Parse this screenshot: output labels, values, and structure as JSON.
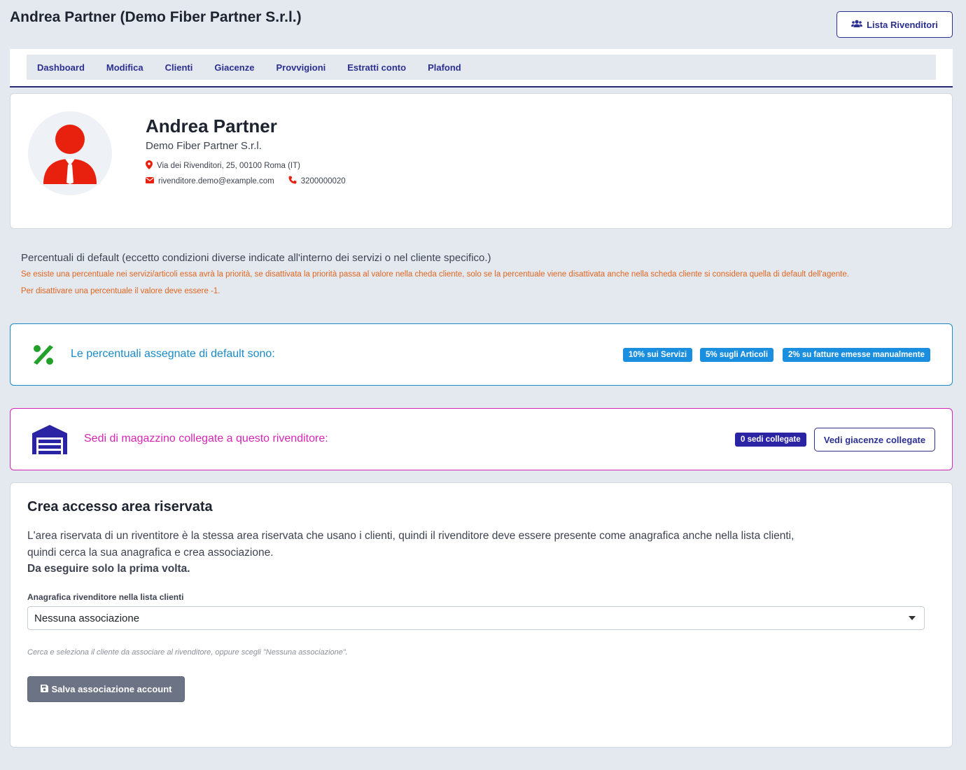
{
  "header": {
    "title": "Andrea Partner (Demo Fiber Partner S.r.l.)",
    "resellers_button": "Lista Rivenditori"
  },
  "nav": {
    "items": [
      "Dashboard",
      "Modifica",
      "Clienti",
      "Giacenze",
      "Provvigioni",
      "Estratti conto",
      "Plafond"
    ]
  },
  "profile": {
    "name": "Andrea Partner",
    "company": "Demo Fiber Partner S.r.l.",
    "address": "Via dei Rivenditori, 25, 00100 Roma (IT)",
    "email": "rivenditore.demo@example.com",
    "phone": "3200000020",
    "avatar_icon": "user-icon",
    "accent_color": "#e8210f"
  },
  "defaults": {
    "title": "Percentuali di default (eccetto condizioni diverse indicate all'interno dei servizi o nel cliente specifico.)",
    "note1": "Se esiste una percentuale nei servizi/articoli essa avrà la priorità, se disattivata la priorità passa al valore nella cheda cliente, solo se la percentuale viene disattivata anche nella scheda cliente si considera quella di default dell'agente.",
    "note2": "Per disattivare una percentuale il valore deve essere -1."
  },
  "percentages": {
    "label": "Le percentuali assegnate di default sono:",
    "badges": [
      "10% sui Servizi",
      "5% sugli Articoli",
      "2% su fatture emesse manualmente"
    ],
    "icon": "percent-icon",
    "color": "#1a8ac9"
  },
  "warehouse": {
    "label": "Sedi di magazzino collegate a questo rivenditore:",
    "badge": "0 sedi collegate",
    "button": "Vedi giacenze collegate",
    "icon": "warehouse-icon",
    "color": "#d626b5"
  },
  "access": {
    "title": "Crea accesso area riservata",
    "line1": "L'area riservata di un riventitore è la stessa area riservata che usano i clienti, quindi il rivenditore deve essere presente come anagrafica anche nella lista clienti,",
    "line2": "quindi cerca la sua anagrafica e crea associazione.",
    "line3": "Da eseguire solo la prima volta.",
    "field_label": "Anagrafica rivenditore nella lista clienti",
    "select_value": "Nessuna associazione",
    "help": "Cerca e seleziona il cliente da associare al rivenditore, oppure scegli \"Nessuna associazione\".",
    "save_button": "Salva associazione account"
  }
}
